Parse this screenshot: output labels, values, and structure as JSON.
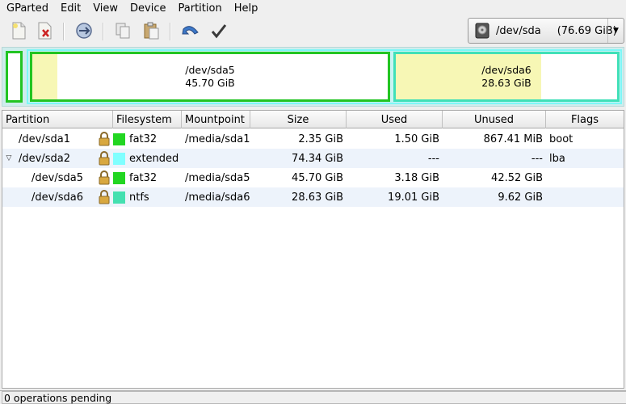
{
  "menubar": {
    "items": [
      "GParted",
      "Edit",
      "View",
      "Device",
      "Partition",
      "Help"
    ]
  },
  "toolbar": {
    "buttons": [
      "new-icon",
      "delete-icon",
      "resize-move-icon",
      "copy-icon",
      "paste-icon",
      "undo-icon",
      "apply-icon"
    ]
  },
  "device_selector": {
    "name": "/dev/sda",
    "size": "(76.69 GiB)"
  },
  "disk_visual": {
    "partitions": [
      {
        "name": "/dev/sda1",
        "color": "#22c422",
        "used_fraction": 0.64,
        "label_name": "",
        "label_size": ""
      },
      {
        "name": "/dev/sda5",
        "color": "#22c422",
        "used_fraction": 0.07,
        "label_name": "/dev/sda5",
        "label_size": "45.70 GiB"
      },
      {
        "name": "/dev/sda6",
        "color": "#40e0b8",
        "used_fraction": 0.66,
        "label_name": "/dev/sda6",
        "label_size": "28.63 GiB"
      }
    ],
    "extended_color": "#7df7f7"
  },
  "table": {
    "columns": [
      "Partition",
      "Filesystem",
      "Mountpoint",
      "Size",
      "Used",
      "Unused",
      "Flags"
    ],
    "rows": [
      {
        "partition": "/dev/sda1",
        "expander": "",
        "filesystem": "fat32",
        "fs_color": "#22d622",
        "mountpoint": "/media/sda1",
        "size": "2.35 GiB",
        "used": "1.50 GiB",
        "unused": "867.41 MiB",
        "flags": "boot"
      },
      {
        "partition": "/dev/sda2",
        "expander": "▽",
        "filesystem": "extended",
        "fs_color": "#80ffff",
        "mountpoint": "",
        "size": "74.34 GiB",
        "used": "---",
        "unused": "---",
        "flags": "lba"
      },
      {
        "partition": "/dev/sda5",
        "expander": "",
        "filesystem": "fat32",
        "fs_color": "#22d622",
        "mountpoint": "/media/sda5",
        "size": "45.70 GiB",
        "used": "3.18 GiB",
        "unused": "42.52 GiB",
        "flags": ""
      },
      {
        "partition": "/dev/sda6",
        "expander": "",
        "filesystem": "ntfs",
        "fs_color": "#44e0b0",
        "mountpoint": "/media/sda6",
        "size": "28.63 GiB",
        "used": "19.01 GiB",
        "unused": "9.62 GiB",
        "flags": ""
      }
    ]
  },
  "statusbar": {
    "text": "0 operations pending"
  }
}
